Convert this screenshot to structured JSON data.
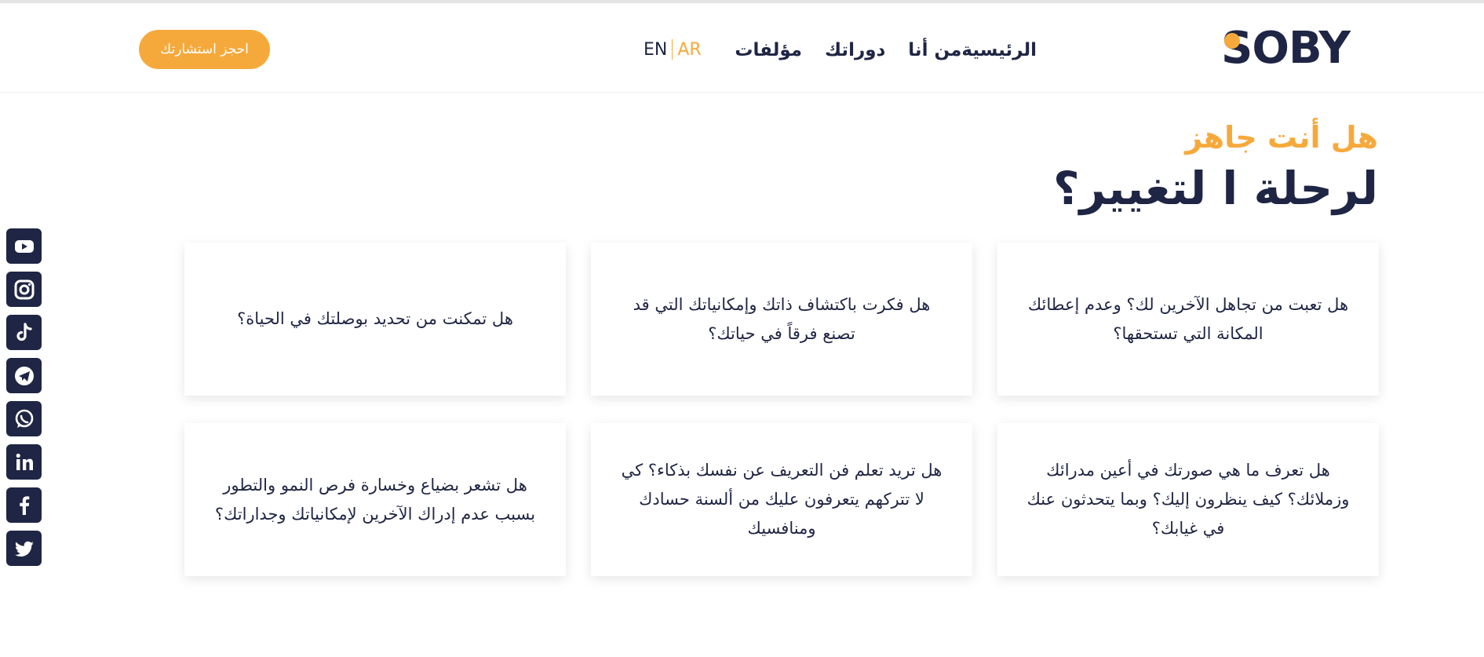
{
  "brand": {
    "logo_text": "SOBY"
  },
  "nav": {
    "items": [
      "الرئيسية",
      "من أنا",
      "دوراتك",
      "مؤلفات"
    ]
  },
  "lang": {
    "ar": "AR",
    "en": "EN"
  },
  "cta_label": "احجز استشارتك",
  "hero": {
    "subtitle": "هل أنت جاهز",
    "title": "لرحلة ا لتغيير؟"
  },
  "cards": [
    "هل تعبت من تجاهل الآخرين لك؟ وعدم إعطائك المكانة التي تستحقها؟",
    "هل فكرت باكتشاف ذاتك وإمكانياتك التي قد تصنع فرقاً في حياتك؟",
    "هل تمكنت من تحديد بوصلتك في الحياة؟",
    "هل تعرف ما هي صورتك في أعين مدرائك وزملائك؟ كيف ينظرون إليك؟ وبما يتحدثون عنك في غيابك؟",
    "هل تريد تعلم فن التعريف عن نفسك بذكاء؟ كي لا تتركهم يتعرفون عليك من ألسنة حسادك ومنافسيك",
    "هل تشعر بضياع وخسارة فرص النمو والتطور بسبب عدم إدراك الآخرين لإمكانياتك وجداراتك؟"
  ],
  "social": [
    {
      "icon": "youtube-icon"
    },
    {
      "icon": "instagram-icon"
    },
    {
      "icon": "tiktok-icon"
    },
    {
      "icon": "telegram-icon"
    },
    {
      "icon": "whatsapp-icon"
    },
    {
      "icon": "linkedin-icon"
    },
    {
      "icon": "facebook-icon"
    },
    {
      "icon": "twitter-icon"
    }
  ],
  "colors": {
    "accent": "#f6a93b",
    "navy": "#1f2544"
  }
}
